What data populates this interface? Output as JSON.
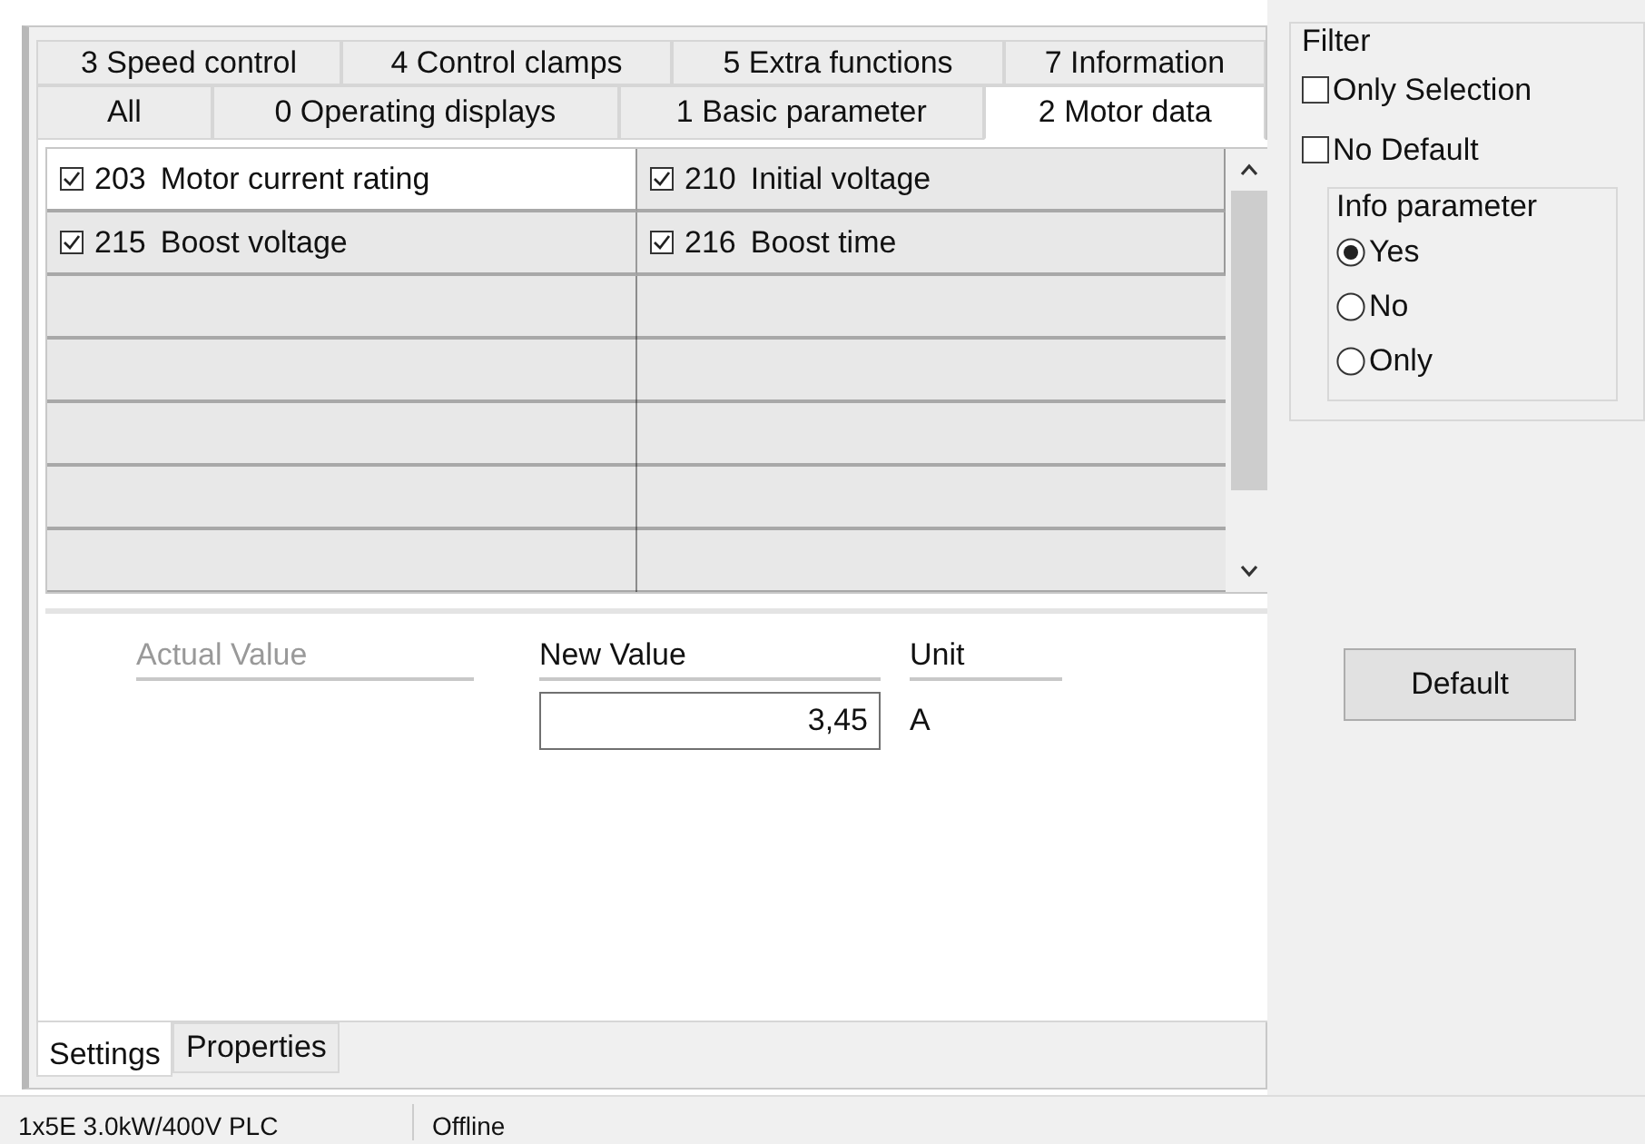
{
  "tab_rows": [
    [
      {
        "label": "3 Speed control",
        "selected": false
      },
      {
        "label": "4 Control clamps",
        "selected": false
      },
      {
        "label": "5 Extra functions",
        "selected": false
      },
      {
        "label": "7 Information",
        "selected": false
      }
    ],
    [
      {
        "label": "All",
        "selected": false
      },
      {
        "label": "0 Operating displays",
        "selected": false
      },
      {
        "label": "1 Basic parameter",
        "selected": false
      },
      {
        "label": "2 Motor data",
        "selected": true
      }
    ]
  ],
  "parameters": [
    [
      {
        "checked": true,
        "number": "203",
        "name": "Motor current rating",
        "selected": true
      },
      {
        "checked": true,
        "number": "210",
        "name": "Initial voltage",
        "selected": false
      }
    ],
    [
      {
        "checked": true,
        "number": "215",
        "name": "Boost voltage",
        "selected": false
      },
      {
        "checked": true,
        "number": "216",
        "name": "Boost time",
        "selected": false
      }
    ]
  ],
  "value_panel": {
    "columns": [
      {
        "label": "Actual Value",
        "disabled": true
      },
      {
        "label": "New Value",
        "disabled": false
      },
      {
        "label": "Unit",
        "disabled": false
      }
    ],
    "new_value": "3,45",
    "unit": "A"
  },
  "bottom_tabs": [
    {
      "label": "Settings",
      "selected": true
    },
    {
      "label": "Properties",
      "selected": false
    }
  ],
  "filter": {
    "title": "Filter",
    "checkboxes": [
      {
        "label": "Only Selection",
        "checked": false
      },
      {
        "label": "No Default",
        "checked": false
      }
    ],
    "info_group": {
      "title": "Info parameter",
      "options": [
        {
          "label": "Yes",
          "selected": true
        },
        {
          "label": "No",
          "selected": false
        },
        {
          "label": "Only",
          "selected": false
        }
      ]
    }
  },
  "default_button": "Default",
  "status_bar": [
    "1x5E 3.0kW/400V PLC",
    "Offline"
  ]
}
